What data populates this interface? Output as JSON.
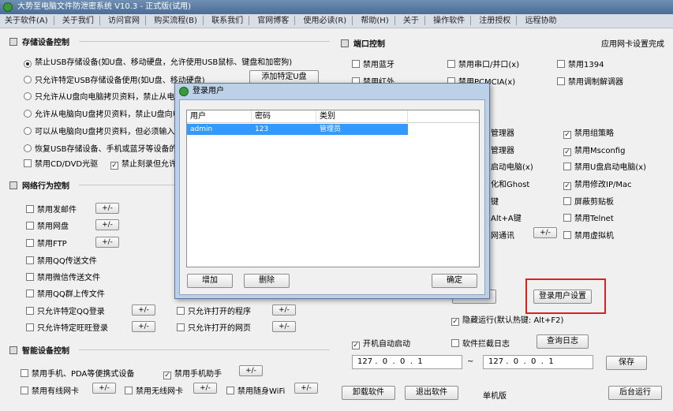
{
  "window": {
    "title": "大势至电脑文件防泄密系统 V10.3 - 正式版(试用)"
  },
  "menu": [
    "关于软件(A)",
    "关于我们",
    "访问官网",
    "购买流程(B)",
    "联系我们",
    "官网博客",
    "使用必读(R)",
    "帮助(H)",
    "关于",
    "操作软件",
    "注册授权",
    "远程协助"
  ],
  "storage": {
    "title": "存储设备控制",
    "options": [
      "禁止USB存储设备(如U盘、移动硬盘，允许使用USB鼠标、键盘和加密狗)",
      "只允许特定USB存储设备使用(如U盘、移动硬盘)",
      "只允许从U盘向电脑拷贝资料，禁止从电",
      "允许从电脑向U盘拷贝资料，禁止U盘向电",
      "可以从电脑向U盘拷贝资料，但必须输入管",
      "恢复USB存储设备、手机或蓝牙等设备的"
    ],
    "add_usb_button": "添加特定U盘",
    "cd": "禁用CD/DVD光驱",
    "burn": "禁止刻录但允许"
  },
  "network": {
    "title": "网络行为控制",
    "items": [
      "禁用发邮件",
      "禁用网盘",
      "禁用FTP",
      "禁用QQ传送文件",
      "禁用微信传送文件",
      "禁用QQ群上传文件",
      "只允许特定QQ登录",
      "只允许特定旺旺登录"
    ],
    "right_items": [
      "只允许打开的程序",
      "只允许打开的网页"
    ],
    "pm": "+/-"
  },
  "smart": {
    "title": "智能设备控制",
    "items": [
      "禁用手机、PDA等便携式设备",
      "禁用手机助手",
      "禁用有线网卡",
      "禁用无线网卡",
      "禁用随身WiFi"
    ]
  },
  "port": {
    "title": "端口控制",
    "status": "应用网卡设置完成",
    "row1": [
      "禁用蓝牙",
      "禁用串口/并口(x)",
      "禁用1394"
    ],
    "row2": [
      "禁用红外",
      "禁用PCMCIA(x)",
      "禁用调制解调器"
    ],
    "mid": [
      "管理器",
      "管理器",
      "启动电脑(x)",
      "化和Ghost",
      "键",
      "Alt+A键",
      "网通讯"
    ],
    "right": [
      "禁用组策略",
      "禁用Msconfig",
      "禁用U盘启动电脑(x)",
      "禁用修改IP/Mac",
      "屏蔽剪贴板",
      "禁用Telnet",
      "禁用虚拟机"
    ]
  },
  "bottom": {
    "hotkey_button": "热键",
    "login_user_settings": "登录用户设置",
    "hide_run": "隐藏运行(默认热键: Alt+F2)",
    "autostart": "开机自动启动",
    "intercept_log": "软件拦截日志",
    "view_log": "查询日志",
    "ip_from": "127 .  0  .  0  .  1",
    "tilde": "~",
    "ip_to": "127 .  0  .  0  .  1",
    "save": "保存",
    "uninstall": "卸载软件",
    "exit": "退出软件",
    "mode": "单机版",
    "background": "后台运行"
  },
  "dialog": {
    "title": "登录用户",
    "columns": [
      "用户",
      "密码",
      "类别"
    ],
    "rows": [
      {
        "user": "admin",
        "password": "123",
        "type": "管理员"
      }
    ],
    "add": "增加",
    "delete": "删除",
    "ok": "确定"
  }
}
